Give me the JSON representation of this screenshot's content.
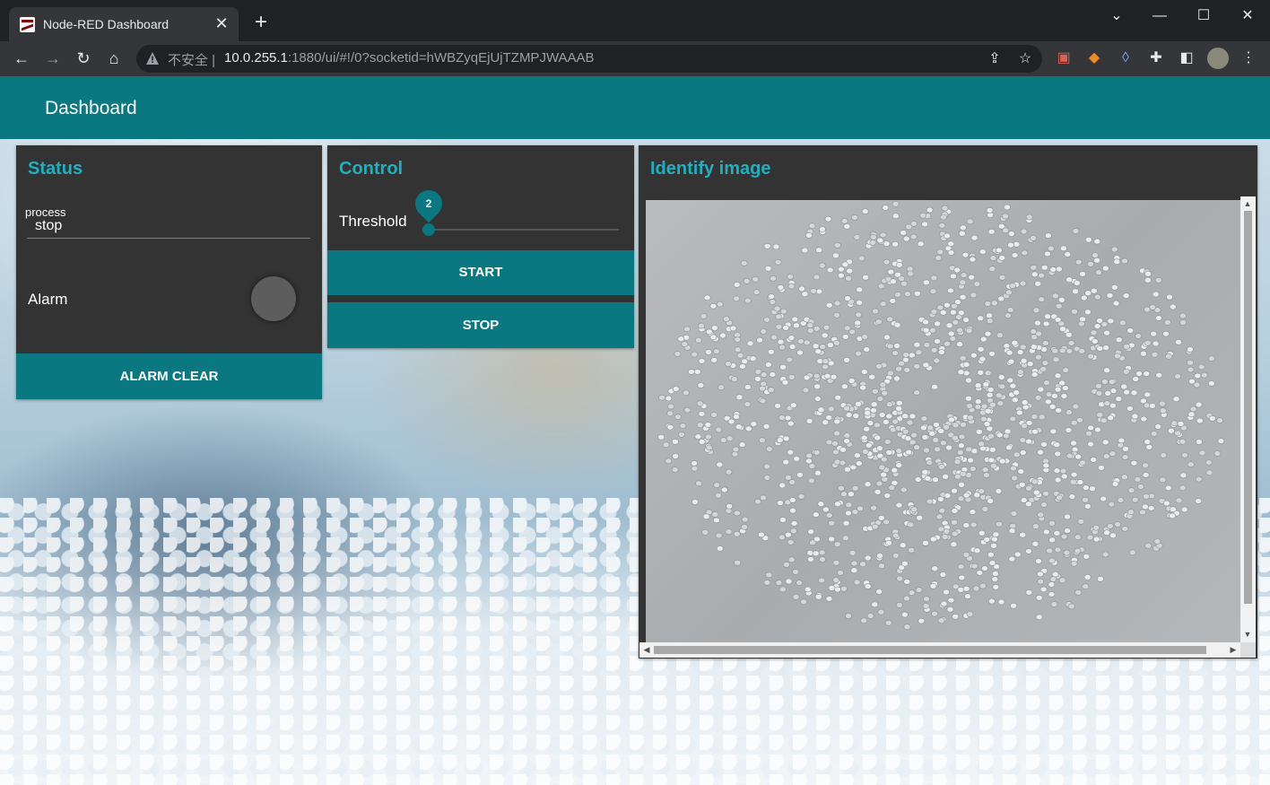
{
  "browser": {
    "tab_title": "Node-RED Dashboard",
    "tab_close": "✕",
    "new_tab": "+",
    "insecure_label": "不安全 |",
    "url_host": "10.0.255.1",
    "url_rest": ":1880/ui/#!/0?socketid=hWBZyqEjUjTZMPJWAAAB"
  },
  "header": {
    "title": "Dashboard"
  },
  "status": {
    "title": "Status",
    "process_label": "process",
    "process_value": "stop",
    "alarm_label": "Alarm",
    "alarm_clear_label": "ALARM CLEAR",
    "led_color": "#5d5d5d"
  },
  "control": {
    "title": "Control",
    "threshold_label": "Threshold",
    "threshold_value": "2",
    "threshold_fraction": 0.0,
    "start_label": "START",
    "stop_label": "STOP"
  },
  "identify": {
    "title": "Identify image"
  },
  "colors": {
    "accent": "#0a7880",
    "title": "#1fb0bd",
    "card": "#333333"
  }
}
